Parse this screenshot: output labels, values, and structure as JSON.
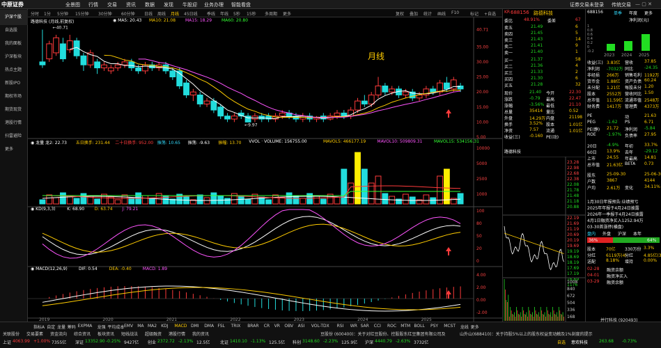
{
  "app": {
    "logo": "中原证券",
    "login_status": "证券交易未登录",
    "sync_label": "传统交易"
  },
  "menu": [
    "全景图",
    "行情",
    "交易",
    "资讯",
    "数据",
    "发现",
    "牛股迎",
    "业务办理",
    "智能看盘"
  ],
  "sidebar": [
    "沪深个股",
    "自选股",
    "我的面板",
    "沪深板块",
    "热点主题",
    "新股IPO",
    "期权市场",
    "期货现货",
    "港股行情",
    "扫雷避险",
    "更多"
  ],
  "periods": [
    "分时",
    "1分",
    "5分钟",
    "15分钟",
    "30分钟",
    "60分钟",
    "日线",
    "周线",
    "月线",
    "45日线",
    "季线",
    "年线",
    "5秒",
    "15秒",
    "多周期",
    "更多"
  ],
  "active_period": "月线",
  "toolbar": [
    "复权",
    "叠加",
    "统计",
    "画线",
    "F10",
    "标记",
    "+自选",
    "返回"
  ],
  "stock": {
    "title": "路德科技 (月线,前复权)",
    "code": "688156",
    "name": "路德科技",
    "kr": "KR"
  },
  "chart_label": "月线",
  "main_chart": {
    "ma_text": [
      "◉ MA5: 20.43",
      "MA10: 21.08",
      "MA15: 18.29",
      "MA60: 20.80"
    ],
    "high_label": "40.71",
    "low_label": "9.97",
    "y_ticks": [
      "40.71",
      "35.00",
      "30.00",
      "25.00",
      "20.00",
      "15.00",
      "10.00",
      "5.00"
    ]
  },
  "vol_panel": {
    "text": [
      "◉ 龙量 龙2: 22.73",
      "五日换手: 231.44",
      "二十日换手: 952.00",
      "振荡: 10.65",
      "振荡: -9.63",
      "振幅: 13.70",
      "VVOL · VOLUME: 156755.00",
      "MAVOL5: 466177.19",
      "MAVOL10: 509809.31",
      "MAVOL15: 534156.31"
    ],
    "y_ticks": [
      "10000",
      "5000",
      "2500",
      "1000"
    ]
  },
  "kdj_panel": {
    "text": [
      "◉ KD(9,3,3)",
      "K: 68.90",
      "D: 63.74",
      "J: 79.21"
    ],
    "y_ticks": [
      "100",
      "80",
      "50",
      "20",
      "0"
    ]
  },
  "macd_panel": {
    "text": [
      "◉ MACD(12,26,9)",
      "DIF: 0.54",
      "DEA: -0.40",
      "MACD: 1.89"
    ],
    "y_ticks": [
      "4.00",
      "2.00",
      "0.00",
      "-2.00"
    ]
  },
  "x_labels": [
    "2019",
    "2020",
    "2021",
    "2022",
    "2023",
    "2024",
    "2025"
  ],
  "quote": {
    "header": {
      "label": "委比",
      "value": "48.91%",
      "label2": "委差",
      "value2": "67"
    },
    "asks": [
      {
        "name": "卖五",
        "price": "21.49",
        "vol": "6"
      },
      {
        "name": "卖四",
        "price": "21.45",
        "vol": "5"
      },
      {
        "name": "卖三",
        "price": "21.43",
        "vol": "14"
      },
      {
        "name": "卖二",
        "price": "21.41",
        "vol": "9"
      },
      {
        "name": "卖一",
        "price": "21.40",
        "vol": "1"
      }
    ],
    "bids": [
      {
        "name": "买一",
        "price": "21.37",
        "vol": "58"
      },
      {
        "name": "买二",
        "price": "21.36",
        "vol": "4"
      },
      {
        "name": "买三",
        "price": "21.33",
        "vol": "2"
      },
      {
        "name": "买四",
        "price": "21.30",
        "vol": "6"
      },
      {
        "name": "买五",
        "price": "21.28",
        "vol": "32"
      }
    ],
    "stats": [
      [
        "现价",
        "21.40",
        "今开",
        "22.30"
      ],
      [
        "涨跌",
        "-0.79",
        "最高",
        "22.47"
      ],
      [
        "涨幅",
        "-3.56%",
        "最低",
        "21.10"
      ],
      [
        "总量",
        "35414",
        "量比",
        "0.52"
      ],
      [
        "外盘",
        "14.29万",
        "内盘",
        "21198"
      ],
      [
        "换手",
        "3.52%",
        "股本",
        "1.01亿"
      ],
      [
        "净资",
        "7.57",
        "流通",
        "1.01亿"
      ],
      [
        "收益(三)",
        "-0.160",
        "PE(动)",
        ""
      ]
    ],
    "intraday_label": "路德科技",
    "intraday_y": [
      "23.28",
      "22.98",
      "22.68",
      "22.38",
      "22.08",
      "21.78",
      "21.48",
      "21.18",
      "20.88"
    ],
    "intraday_y2": [
      "22.19",
      "21.69",
      "21.19",
      "20.69",
      "20.19",
      "19.69",
      "19.19",
      "18.69",
      "18.19",
      "17.69",
      "17.19",
      "16.69",
      "1176"
    ],
    "mini_vol_y": [
      "1008",
      "840",
      "672",
      "504",
      "336",
      "168"
    ]
  },
  "finance": {
    "code": "688156",
    "tabs": [
      "单季",
      "年度",
      "更多"
    ],
    "chart_title": "净利润(元)",
    "years": [
      "2023",
      "2024",
      "2025"
    ],
    "y_ticks": [
      "1",
      "0.8",
      "0.6",
      "0.4",
      "0.2",
      "0",
      "-0.2"
    ],
    "rows": [
      [
        "收益(三)",
        "3.83亿",
        "营收",
        "37.85"
      ],
      [
        "净利润",
        "-7032万",
        "同比",
        "-24.35"
      ],
      [
        "非经损",
        "266万",
        "销售毛利",
        "1192万"
      ],
      [
        "货币金",
        "1.88亿",
        "资产负债",
        "60.24"
      ],
      [
        "未分配",
        "1.21亿",
        "每股未分",
        "1.20"
      ],
      [
        "股本",
        "2552万",
        "营收同比",
        "1.50"
      ],
      [
        "总市值",
        "11.59亿",
        "流通市值",
        "2548万"
      ],
      [
        "财务费",
        "1417万",
        "管理费",
        "4373万"
      ],
      [
        "PE",
        "",
        "动",
        "21.63"
      ],
      [
        "PEG",
        "-1.62",
        "PS",
        "6.71"
      ],
      [
        "PE(静)",
        "21.72",
        "净利润",
        "-5.84"
      ],
      [
        "ROE",
        "-1.97%",
        "负债率",
        "27.95"
      ],
      [
        "20日",
        "-4.9%",
        "年初",
        "33.7%"
      ],
      [
        "60日",
        "13.9%",
        "去年",
        "-29.12"
      ],
      [
        "上市",
        "24.55",
        "年最高",
        "14.81"
      ],
      [
        "总市值",
        "21.63亿",
        "BETA",
        "0.73"
      ],
      [
        "股东",
        "25-09-30",
        "",
        "25-06-30"
      ],
      [
        "户数",
        "3867",
        "",
        "4144"
      ],
      [
        "户均",
        "2.61万",
        "变化",
        "34.11%"
      ]
    ],
    "notes": [
      "1月30日年报预告:业绩预亏",
      "2025年年报于4月24日披露",
      "2026年一季报于4月24日披露",
      "4月1日融资净买入1252.94万",
      "03-30首涨停(横盘)"
    ],
    "board_tabs": [
      "盘内",
      "外盘",
      "沪深",
      "本年"
    ],
    "bar_left": "36%",
    "bar_right": "64%",
    "extra": [
      [
        "股本",
        "70亿",
        "330万份",
        "3.3%"
      ],
      [
        "分红",
        "6119万(4)",
        "分红",
        "4.85亿(3)"
      ],
      [
        "送配",
        "8.18%",
        "增持",
        "0.00%"
      ]
    ],
    "events": [
      "融资余额",
      "融资净买入",
      "融资余额"
    ],
    "event_dates": [
      "02-28",
      "04-01",
      "03-29"
    ]
  },
  "indicators": [
    "指标A",
    "自定",
    "龙量",
    "筹码",
    "EXPMA",
    "龙强",
    "平均成本",
    "EMV",
    "MA",
    "MA2",
    "KDJ",
    "MACD",
    "DMI",
    "DMA",
    "FSL",
    "TRIX",
    "BRAR",
    "CR",
    "VR",
    "OBV",
    "ASI",
    "VOL-TDX",
    "RSI",
    "WR",
    "SAR",
    "CCI",
    "ROC",
    "MTM",
    "BOLL",
    "PSY",
    "MCST",
    "龙线",
    "更多"
  ],
  "active_indicator": "MACD",
  "bottom_tabs": [
    "关联股份",
    "交易要素",
    "资金流向",
    "综合资讯",
    "板块资讯",
    "短线战法",
    "超级融资",
    "港股行情",
    "我的资讯"
  ],
  "news": [
    "山外山(688410)：关于持股5%以上的股东权益变动触及1%刻度的提示",
    "豆股份 (600400)：关于对红豆股份、控股股东红豆集团有限公司及"
  ],
  "status": {
    "indices": [
      {
        "name": "上证",
        "value": "4063.99",
        "change": "+1.00%",
        "amount": "7355亿",
        "color": "red"
      },
      {
        "name": "深证",
        "value": "13352.90",
        "change": "-0.25%",
        "amount": "9427亿",
        "color": "green"
      },
      {
        "name": "创业",
        "value": "2372.72",
        "change": "-2.13%",
        "amount": "12.5亿",
        "color": "green"
      },
      {
        "name": "北证",
        "value": "1410.10",
        "change": "-1.13%",
        "amount": "125.5亿",
        "color": "green"
      },
      {
        "name": "科创",
        "value": "3148.60",
        "change": "-2.23%",
        "amount": "125.9亿",
        "color": "green"
      },
      {
        "name": "沪深",
        "value": "4440.79",
        "change": "-2.63%",
        "amount": "3732亿",
        "color": "green"
      }
    ],
    "right": "并行科技 (920493)",
    "right2": "自选",
    "right3": "意欢科技",
    "right4": "263.68",
    "right5": "-0.73%"
  },
  "colors": {
    "up": "#ff3b3b",
    "down": "#22dd22",
    "ma5": "#ffffff",
    "ma10": "#ffcc00",
    "ma15": "#ff55ff",
    "ma60": "#33ff33",
    "accent": "#ffcc00"
  }
}
